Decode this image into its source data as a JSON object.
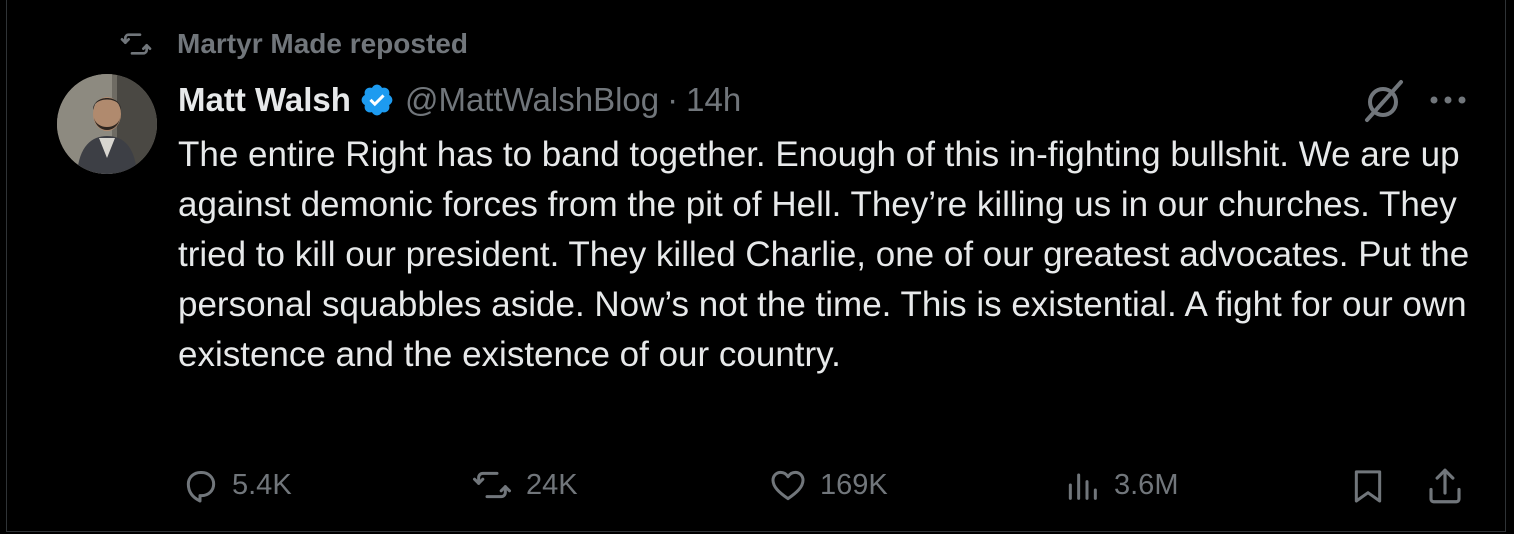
{
  "repost": {
    "text": "Martyr Made reposted"
  },
  "author": {
    "display_name": "Matt Walsh",
    "handle": "@MattWalshBlog",
    "separator": "·",
    "time": "14h",
    "verified": true
  },
  "tweet": {
    "text": "The entire Right has to band together. Enough of this in-fighting bullshit. We are up against demonic forces from the pit of Hell. They’re killing us in our churches. They tried to kill our president. They killed Charlie, one of our greatest advocates. Put the personal squabbles aside. Now’s not the time. This is existential. A fight for our own existence and the existence of our country."
  },
  "metrics": {
    "replies": "5.4K",
    "reposts": "24K",
    "likes": "169K",
    "views": "3.6M"
  },
  "icons": {
    "repost_header": "repost-icon",
    "verified": "verified-badge-icon",
    "grok": "grok-icon",
    "more": "more-icon",
    "reply": "reply-icon",
    "repost": "repost-icon",
    "like": "heart-icon",
    "views": "views-icon",
    "bookmark": "bookmark-icon",
    "share": "share-icon"
  },
  "colors": {
    "background": "#000000",
    "text": "#e7e9ea",
    "secondary": "#71767b",
    "verified": "#1d9bf0"
  }
}
